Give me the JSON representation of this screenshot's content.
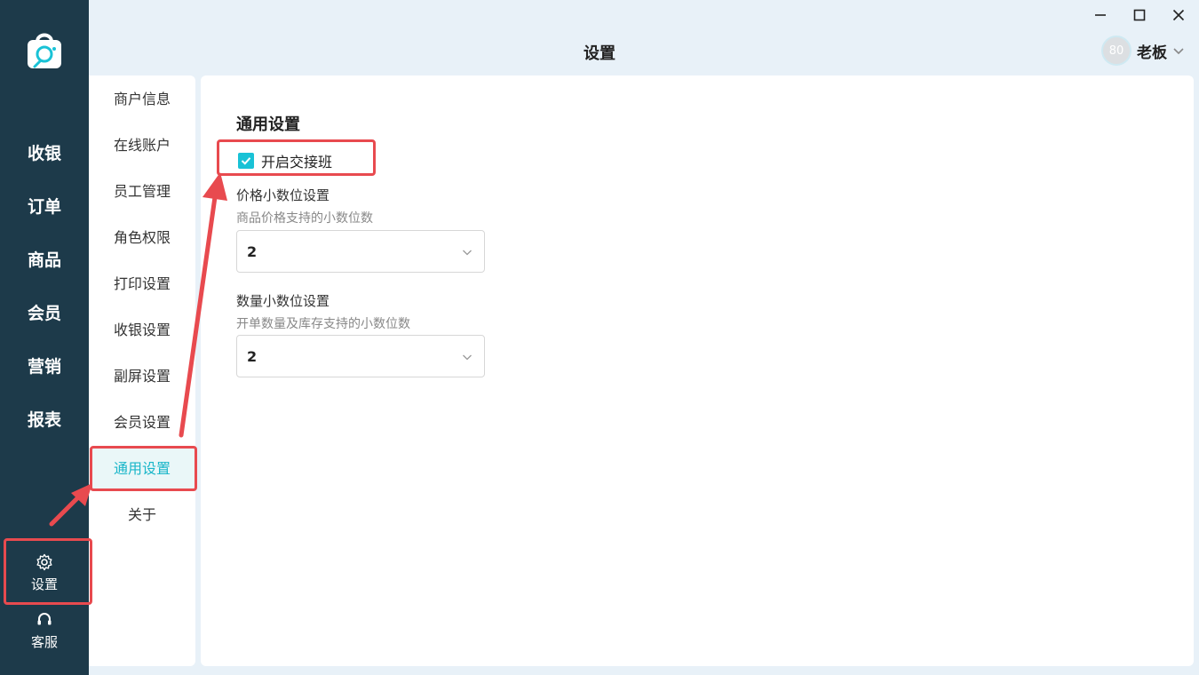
{
  "nav": {
    "logo_icon": "shopping-bag-logo-icon",
    "items": [
      {
        "label": "收银"
      },
      {
        "label": "订单"
      },
      {
        "label": "商品"
      },
      {
        "label": "会员"
      },
      {
        "label": "营销"
      },
      {
        "label": "报表"
      }
    ],
    "settings": {
      "label": "设置",
      "icon": "gear-icon"
    },
    "support": {
      "label": "客服",
      "icon": "headset-icon"
    }
  },
  "header": {
    "title": "设置",
    "user": {
      "avatar_text": "80",
      "name": "老板"
    }
  },
  "submenu": {
    "items": [
      {
        "label": "商户信息"
      },
      {
        "label": "在线账户"
      },
      {
        "label": "员工管理"
      },
      {
        "label": "角色权限"
      },
      {
        "label": "打印设置"
      },
      {
        "label": "收银设置"
      },
      {
        "label": "副屏设置"
      },
      {
        "label": "会员设置"
      },
      {
        "label": "通用设置"
      },
      {
        "label": "关于"
      }
    ],
    "active_index": 8
  },
  "main": {
    "section_title": "通用设置",
    "shift_checkbox": {
      "label": "开启交接班",
      "checked": true
    },
    "price_decimal": {
      "title": "价格小数位设置",
      "subtitle": "商品价格支持的小数位数",
      "value": "2"
    },
    "qty_decimal": {
      "title": "数量小数位设置",
      "subtitle": "开单数量及库存支持的小数位数",
      "value": "2"
    }
  },
  "colors": {
    "nav_bg": "#1d3a4a",
    "accent": "#19c2d6",
    "annotation": "#e84a4f"
  }
}
